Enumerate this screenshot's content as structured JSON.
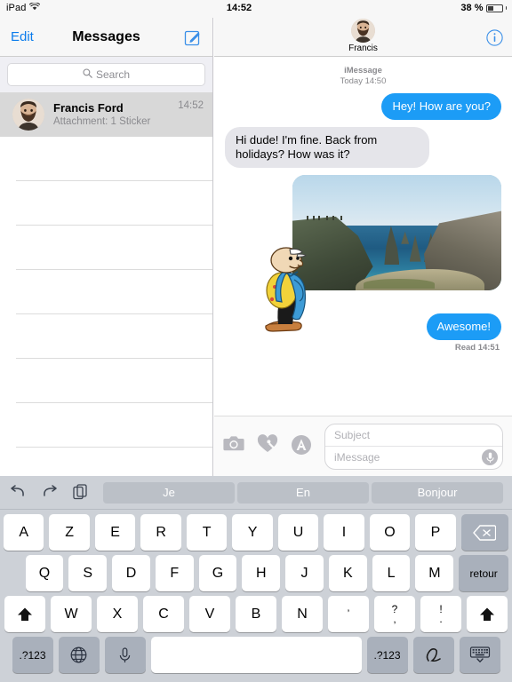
{
  "status_bar": {
    "device": "iPad",
    "wifi_icon": "wifi-icon",
    "time": "14:52",
    "battery_percent": "38 %",
    "battery_level": 38
  },
  "sidebar": {
    "edit_label": "Edit",
    "title": "Messages",
    "compose_icon": "compose-icon",
    "search": {
      "placeholder": "Search",
      "icon": "search-icon"
    },
    "conversations": [
      {
        "name": "Francis Ford",
        "preview": "Attachment: 1 Sticker",
        "time": "14:52",
        "selected": true
      }
    ],
    "empty_rows": 12
  },
  "chat": {
    "peer_name": "Francis",
    "info_icon": "info-icon",
    "avatar_name": "avatar",
    "meta": {
      "service": "iMessage",
      "time": "Today 14:50"
    },
    "messages": [
      {
        "id": "m1",
        "direction": "out",
        "text": "Hey! How are you?"
      },
      {
        "id": "m2",
        "direction": "in",
        "text": "Hi dude! I'm fine. Back from holidays? How was it?"
      },
      {
        "id": "m3",
        "direction": "in",
        "type": "photo",
        "text": ""
      },
      {
        "id": "m4",
        "direction": "out",
        "text": "Awesome!"
      }
    ],
    "receipt": "Read 14:51",
    "composer": {
      "camera_icon": "camera-icon",
      "digital_touch_icon": "digital-touch-icon",
      "app_store_icon": "app-store-icon",
      "subject_placeholder": "Subject",
      "message_placeholder": "iMessage",
      "mic_icon": "microphone-icon"
    }
  },
  "keyboard": {
    "tools": [
      "undo-icon",
      "redo-icon",
      "paste-icon"
    ],
    "predictions": [
      "Je",
      "En",
      "Bonjour"
    ],
    "row1": [
      "A",
      "Z",
      "E",
      "R",
      "T",
      "Y",
      "U",
      "I",
      "O",
      "P"
    ],
    "backspace_icon": "backspace-icon",
    "row2": [
      "Q",
      "S",
      "D",
      "F",
      "G",
      "H",
      "J",
      "K",
      "L",
      "M"
    ],
    "return_label": "retour",
    "row3": [
      "W",
      "X",
      "C",
      "V",
      "B",
      "N"
    ],
    "shift_icon": "shift-icon",
    "punct_keys": [
      {
        "top": "’",
        "bot": ""
      },
      {
        "top": "?",
        "bot": ","
      },
      {
        "top": "!",
        "bot": "."
      }
    ],
    "numbers_label": ".?123",
    "globe_icon": "globe-icon",
    "dictation_icon": "microphone-icon",
    "space_label": "",
    "numbers_label_right": ".?123",
    "handwriting_icon": "handwriting-icon",
    "hide_keyboard_icon": "hide-keyboard-icon"
  },
  "colors": {
    "imessage_blue": "#1c9cf6",
    "received_gray": "#e5e5ea",
    "tint": "#0b7cec",
    "keyboard_bg": "#cdd1d7",
    "selected_row": "#d8d8d8"
  }
}
